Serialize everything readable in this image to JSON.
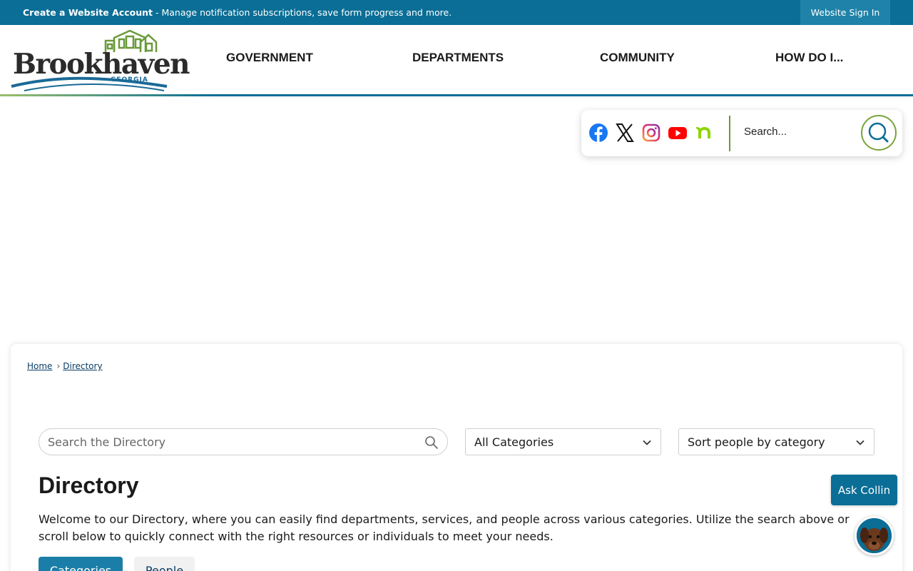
{
  "banner": {
    "create_account": "Create a Website Account",
    "message": " - Manage notification subscriptions, save form progress and more.",
    "sign_in": "Website Sign In"
  },
  "logo": {
    "name": "Brookhaven",
    "state": "GEORGIA"
  },
  "nav": {
    "items": [
      {
        "label": "GOVERNMENT"
      },
      {
        "label": "DEPARTMENTS"
      },
      {
        "label": "COMMUNITY"
      },
      {
        "label": "HOW DO I..."
      }
    ]
  },
  "social": {
    "icons": [
      "facebook-icon",
      "x-twitter-icon",
      "instagram-icon",
      "youtube-icon",
      "nextdoor-icon"
    ],
    "search_label": "Search..."
  },
  "breadcrumb": {
    "home": "Home",
    "separator": "›",
    "current": "Directory"
  },
  "directory": {
    "search_placeholder": "Search the Directory",
    "category_select": "All Categories",
    "sort_select": "Sort people by category",
    "title": "Directory",
    "description": "Welcome to our Directory, where you can easily find departments, services, and people across various categories. Utilize the search above or scroll below to quickly connect with the right resources or individuals to meet your needs.",
    "tabs": [
      {
        "label": "Categories",
        "active": true
      },
      {
        "label": "People",
        "active": false
      }
    ]
  },
  "chat": {
    "ask_label": "Ask Collin"
  },
  "colors": {
    "primary": "#0a6e96",
    "accent_green": "#7aa33a",
    "tab_active": "#1a7ea8"
  }
}
